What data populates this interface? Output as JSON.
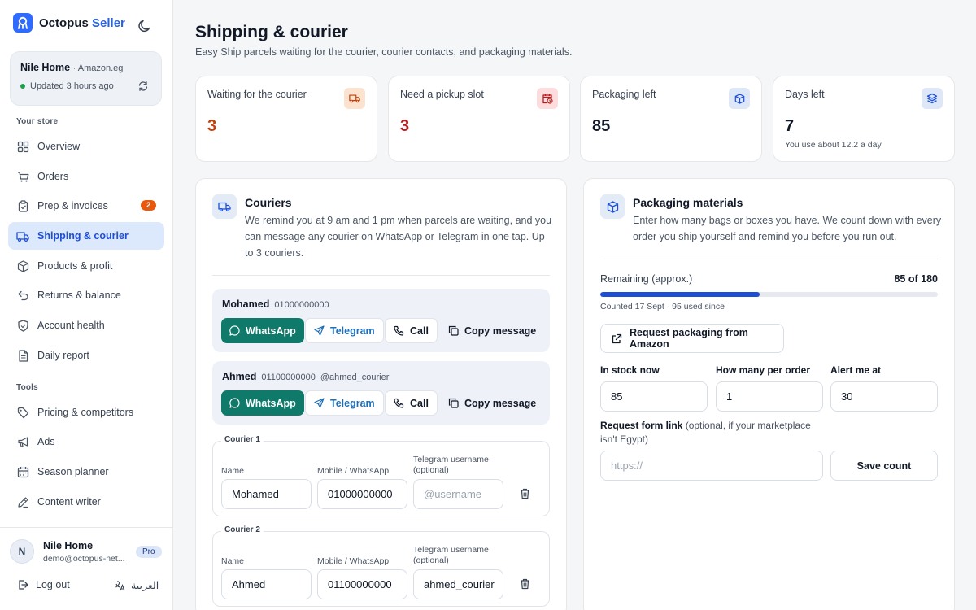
{
  "brand": {
    "name": "Octopus",
    "accent": "Seller"
  },
  "store": {
    "name": "Nile Home",
    "marketplace": "Amazon.eg",
    "status": "Updated 3 hours ago"
  },
  "sidebar": {
    "store_section": "Your store",
    "items": [
      {
        "label": "Overview"
      },
      {
        "label": "Orders"
      },
      {
        "label": "Prep & invoices",
        "badge": "2"
      },
      {
        "label": "Shipping & courier"
      },
      {
        "label": "Products & profit"
      },
      {
        "label": "Returns & balance"
      },
      {
        "label": "Account health"
      },
      {
        "label": "Daily report"
      }
    ],
    "tools_section": "Tools",
    "tools": [
      {
        "label": "Pricing & competitors"
      },
      {
        "label": "Ads"
      },
      {
        "label": "Season planner"
      },
      {
        "label": "Content writer"
      }
    ]
  },
  "user": {
    "initial": "N",
    "name": "Nile Home",
    "email": "demo@octopus-net...",
    "plan": "Pro"
  },
  "footer": {
    "logout": "Log out",
    "language": "العربية"
  },
  "page": {
    "title": "Shipping & courier",
    "subtitle": "Easy Ship parcels waiting for the courier, courier contacts, and packaging materials."
  },
  "stats": [
    {
      "label": "Waiting for the courier",
      "value": "3",
      "icon": "truck-icon"
    },
    {
      "label": "Need a pickup slot",
      "value": "3",
      "icon": "calendar-clock-icon"
    },
    {
      "label": "Packaging left",
      "value": "85",
      "icon": "box-icon"
    },
    {
      "label": "Days left",
      "value": "7",
      "note": "You use about 12.2 a day",
      "icon": "layers-icon"
    }
  ],
  "couriers": {
    "title": "Couriers",
    "description": "We remind you at 9 am and 1 pm when parcels are waiting, and you can message any courier on WhatsApp or Telegram in one tap. Up to 3 couriers.",
    "buttons": {
      "whatsapp": "WhatsApp",
      "telegram": "Telegram",
      "call": "Call",
      "copy": "Copy message"
    },
    "list": [
      {
        "name": "Mohamed",
        "phone": "01000000000",
        "telegram": ""
      },
      {
        "name": "Ahmed",
        "phone": "01100000000",
        "telegram": "@ahmed_courier"
      }
    ],
    "form_labels": {
      "name": "Name",
      "mobile": "Mobile / WhatsApp",
      "telegram_line1": "Telegram username",
      "telegram_line2": "(optional)"
    },
    "forms": [
      {
        "legend": "Courier 1",
        "name": "Mohamed",
        "mobile": "01000000000",
        "telegram": "",
        "telegram_placeholder": "@username"
      },
      {
        "legend": "Courier 2",
        "name": "Ahmed",
        "mobile": "01100000000",
        "telegram": "ahmed_courier",
        "telegram_placeholder": "@username"
      }
    ]
  },
  "packaging": {
    "title": "Packaging materials",
    "description": "Enter how many bags or boxes you have. We count down with every order you ship yourself and remind you before you run out.",
    "remaining_label": "Remaining (approx.)",
    "remaining_text": "85 of 180",
    "remaining_fraction": 0.472,
    "counted": "Counted 17 Sept · 95 used since",
    "request_button": "Request packaging from Amazon",
    "fields": [
      {
        "label": "In stock now",
        "value": "85"
      },
      {
        "label": "How many per order",
        "value": "1"
      },
      {
        "label": "Alert me at",
        "value": "30"
      }
    ],
    "link_label": "Request form link",
    "link_optional": "(optional, if your marketplace isn't Egypt)",
    "link_placeholder": "https://",
    "save_button": "Save count"
  },
  "colors": {
    "accent": "#1d4ed8",
    "whatsapp": "#0f7a6a",
    "warning": "#c2410c",
    "danger": "#b91c1c",
    "badge": "#ea580c"
  }
}
